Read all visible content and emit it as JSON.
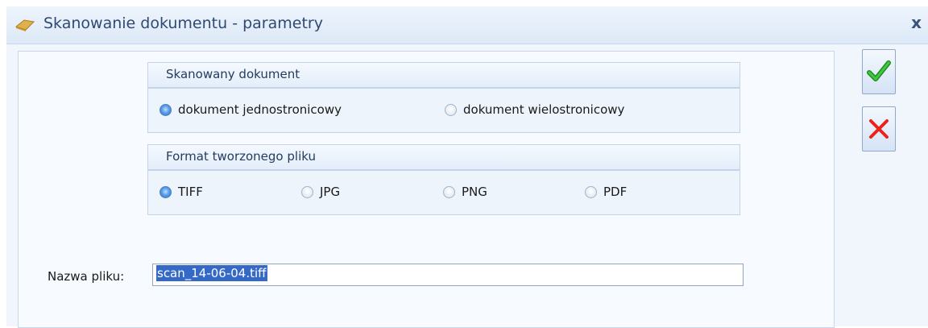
{
  "window": {
    "title": "Skanowanie dokumentu - parametry",
    "close_label": "x"
  },
  "icons": {
    "title_icon": "eraser-icon",
    "ok_icon": "checkmark-icon",
    "cancel_icon": "red-x-icon"
  },
  "scan_group": {
    "title": "Skanowany dokument",
    "options": [
      {
        "label": "dokument jednostronicowy",
        "checked": true
      },
      {
        "label": "dokument wielostronicowy",
        "checked": false
      }
    ]
  },
  "format_group": {
    "title": "Format tworzonego pliku",
    "options": [
      {
        "label": "TIFF",
        "checked": true
      },
      {
        "label": "JPG",
        "checked": false
      },
      {
        "label": "PNG",
        "checked": false
      },
      {
        "label": "PDF",
        "checked": false
      }
    ]
  },
  "file": {
    "label": "Nazwa pliku:",
    "value": "scan_14-06-04.tiff"
  },
  "colors": {
    "accent": "#3469c8",
    "ok_green": "#2ea82e",
    "cancel_red": "#e8221f"
  }
}
